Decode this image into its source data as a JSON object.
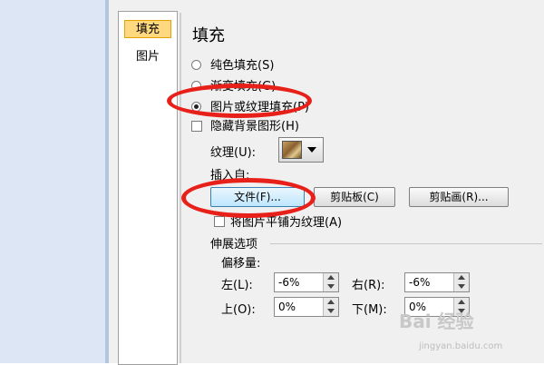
{
  "nav": {
    "items": [
      {
        "label": "填充"
      },
      {
        "label": "图片"
      }
    ]
  },
  "fill": {
    "title": "填充",
    "options": [
      {
        "label": "纯色填充(S)"
      },
      {
        "label": "渐变填充(G)"
      },
      {
        "label": "图片或纹理填充(P)"
      }
    ],
    "hide_background": "隐藏背景图形(H)",
    "texture_label": "纹理(U):",
    "texture_icon": "texture-swatch-icon",
    "insert_from": "插入自:",
    "buttons": {
      "file": "文件(F)...",
      "clipboard": "剪贴板(C)",
      "clipart": "剪贴画(R)..."
    },
    "tile": "将图片平铺为纹理(A)"
  },
  "stretch": {
    "header": "伸展选项",
    "offset_label": "偏移量:",
    "left": {
      "label": "左(L):",
      "value": "-6%"
    },
    "right": {
      "label": "右(R):",
      "value": "-6%"
    },
    "top": {
      "label": "上(O):",
      "value": "0%"
    },
    "bottom": {
      "label": "下(M):",
      "value": "0%"
    }
  },
  "watermark": {
    "text": "Bai 经验",
    "url": "jingyan.baidu.com"
  },
  "colors": {
    "highlight": "#e8201a",
    "nav_selected": "#ffd980"
  }
}
